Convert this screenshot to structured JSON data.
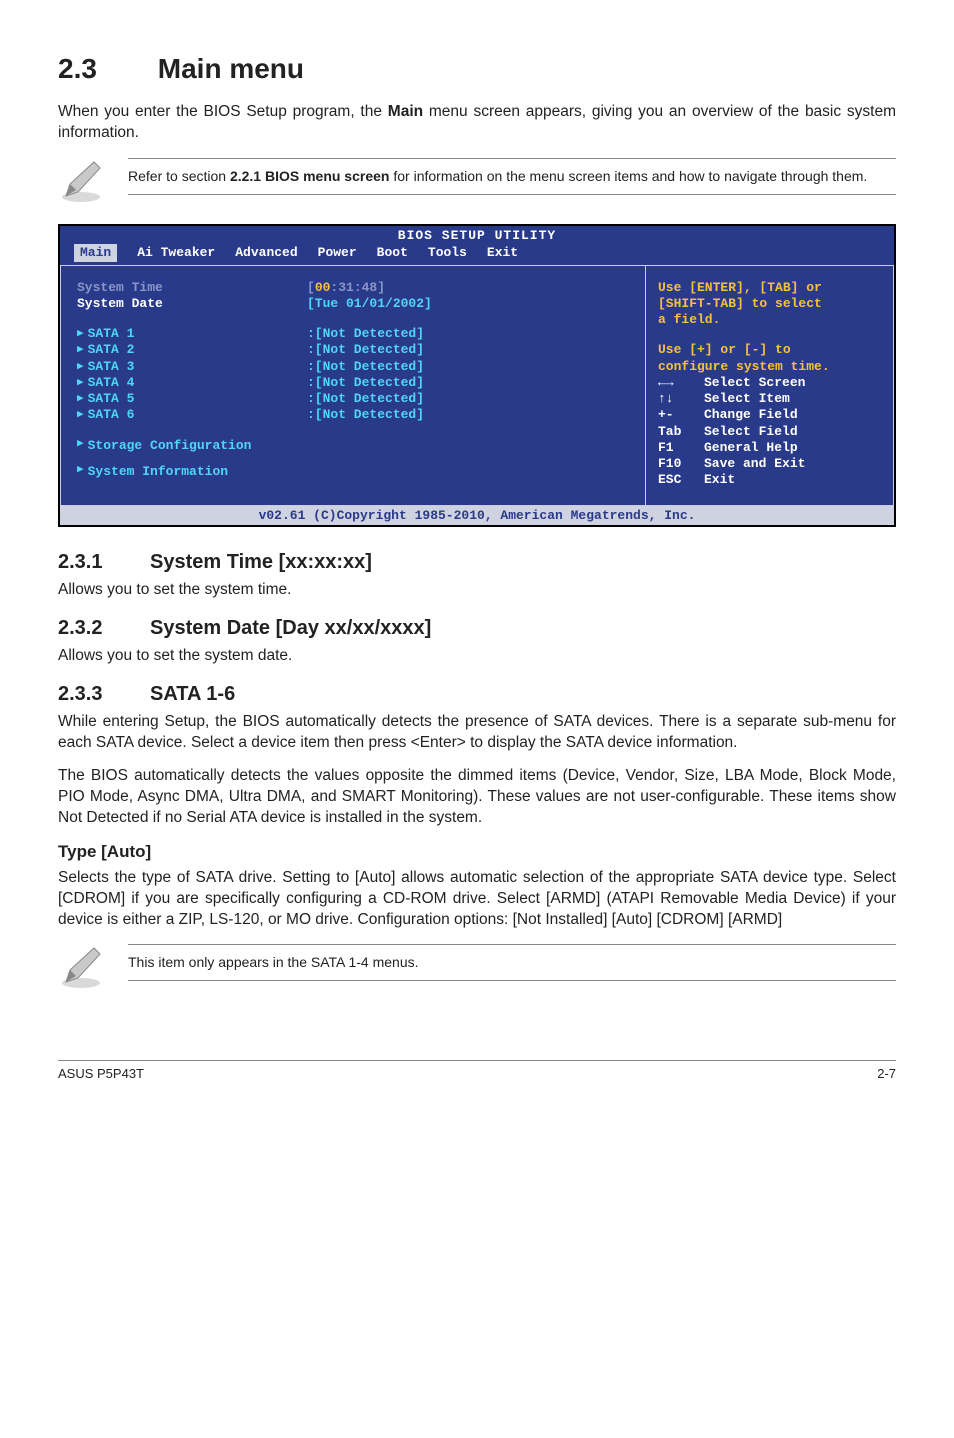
{
  "section": {
    "number": "2.3",
    "title": "Main menu",
    "intro": "When you enter the BIOS Setup program, the Main menu screen appears, giving you an overview of the basic system information.",
    "intro_bold": "Main"
  },
  "note1": {
    "prefix": "Refer to section ",
    "bold": "2.2.1 BIOS menu screen",
    "suffix": " for information on the menu screen items and how to navigate through them."
  },
  "bios": {
    "title": "BIOS SETUP UTILITY",
    "tabs": [
      "Main",
      "Ai Tweaker",
      "Advanced",
      "Power",
      "Boot",
      "Tools",
      "Exit"
    ],
    "active_tab": "Main",
    "left": {
      "system_time_label": "System Time",
      "system_time_value_pre": "[",
      "system_time_value_hl": "00",
      "system_time_value_post": ":31:48]",
      "system_date_label": "System Date",
      "system_date_value": "[Tue 01/01/2002]",
      "sata": [
        {
          "label": "SATA 1",
          "value": ":[Not Detected]"
        },
        {
          "label": "SATA 2",
          "value": ":[Not Detected]"
        },
        {
          "label": "SATA 3",
          "value": ":[Not Detected]"
        },
        {
          "label": "SATA 4",
          "value": ":[Not Detected]"
        },
        {
          "label": "SATA 5",
          "value": ":[Not Detected]"
        },
        {
          "label": "SATA 6",
          "value": ":[Not Detected]"
        }
      ],
      "storage_config": "Storage Configuration",
      "sysinfo": "System Information"
    },
    "right": {
      "help_top1": "Use [ENTER], [TAB] or",
      "help_top2": "[SHIFT-TAB] to select",
      "help_top3": "a field.",
      "help_mid1": "Use [+] or [-] to",
      "help_mid2": "configure system time.",
      "legend": [
        {
          "key": "←→",
          "label": "Select Screen"
        },
        {
          "key": "↑↓",
          "label": "Select Item"
        },
        {
          "key": "+-",
          "label": "Change Field"
        },
        {
          "key": "Tab",
          "label": "Select Field"
        },
        {
          "key": "F1",
          "label": "General Help"
        },
        {
          "key": "F10",
          "label": "Save and Exit"
        },
        {
          "key": "ESC",
          "label": "Exit"
        }
      ]
    },
    "footer": "v02.61 (C)Copyright 1985-2010, American Megatrends, Inc."
  },
  "s231": {
    "num": "2.3.1",
    "title": "System Time [xx:xx:xx]",
    "body": "Allows you to set the system time."
  },
  "s232": {
    "num": "2.3.2",
    "title": "System Date [Day xx/xx/xxxx]",
    "body": "Allows you to set the system date."
  },
  "s233": {
    "num": "2.3.3",
    "title": "SATA 1-6",
    "p1": "While entering Setup, the BIOS automatically detects the presence of SATA devices. There is a separate sub-menu for each SATA device. Select a device item then press <Enter> to display the SATA device information.",
    "p2": "The BIOS automatically detects the values opposite the dimmed items (Device, Vendor, Size, LBA Mode, Block Mode, PIO Mode, Async DMA, Ultra DMA, and SMART Monitoring). These values are not user-configurable. These items show Not Detected if no Serial ATA device is installed in the system."
  },
  "type_auto": {
    "title": "Type [Auto]",
    "body": "Selects the type of SATA drive. Setting to [Auto] allows automatic selection of the appropriate SATA device type. Select [CDROM] if you are specifically configuring a CD-ROM drive. Select [ARMD] (ATAPI Removable Media Device) if your device is either a ZIP, LS-120, or MO drive. Configuration options: [Not Installed] [Auto] [CDROM] [ARMD]"
  },
  "note2": {
    "text": "This item only appears in the SATA 1-4 menus."
  },
  "footer": {
    "left": "ASUS P5P43T",
    "right": "2-7"
  }
}
